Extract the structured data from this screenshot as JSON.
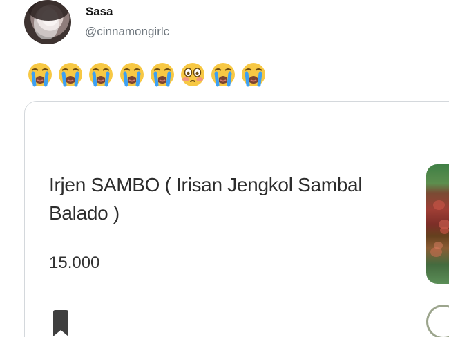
{
  "post": {
    "author": {
      "name": "Sasa",
      "handle": "@cinnamongirlc"
    },
    "emoji_reactions": [
      "loudly-crying-face-emoji",
      "loudly-crying-face-emoji",
      "loudly-crying-face-emoji",
      "loudly-crying-face-emoji",
      "loudly-crying-face-emoji",
      "flushed-face-emoji",
      "loudly-crying-face-emoji",
      "loudly-crying-face-emoji"
    ]
  },
  "menu_card": {
    "item_title": "Irjen SAMBO ( Irisan Jengkol Sambal Balado )",
    "price": "15.000",
    "icons": {
      "bookmark": "bookmark-icon",
      "add": "add-button-icon",
      "thumbnail": "food-thumbnail"
    }
  },
  "colors": {
    "text": "#0f1419",
    "muted": "#6e767d",
    "card_border": "#d4d8dc",
    "emoji_yellow": "#f7c844",
    "emoji_blue": "#3da0f2",
    "add_outline": "#9ca58d"
  }
}
